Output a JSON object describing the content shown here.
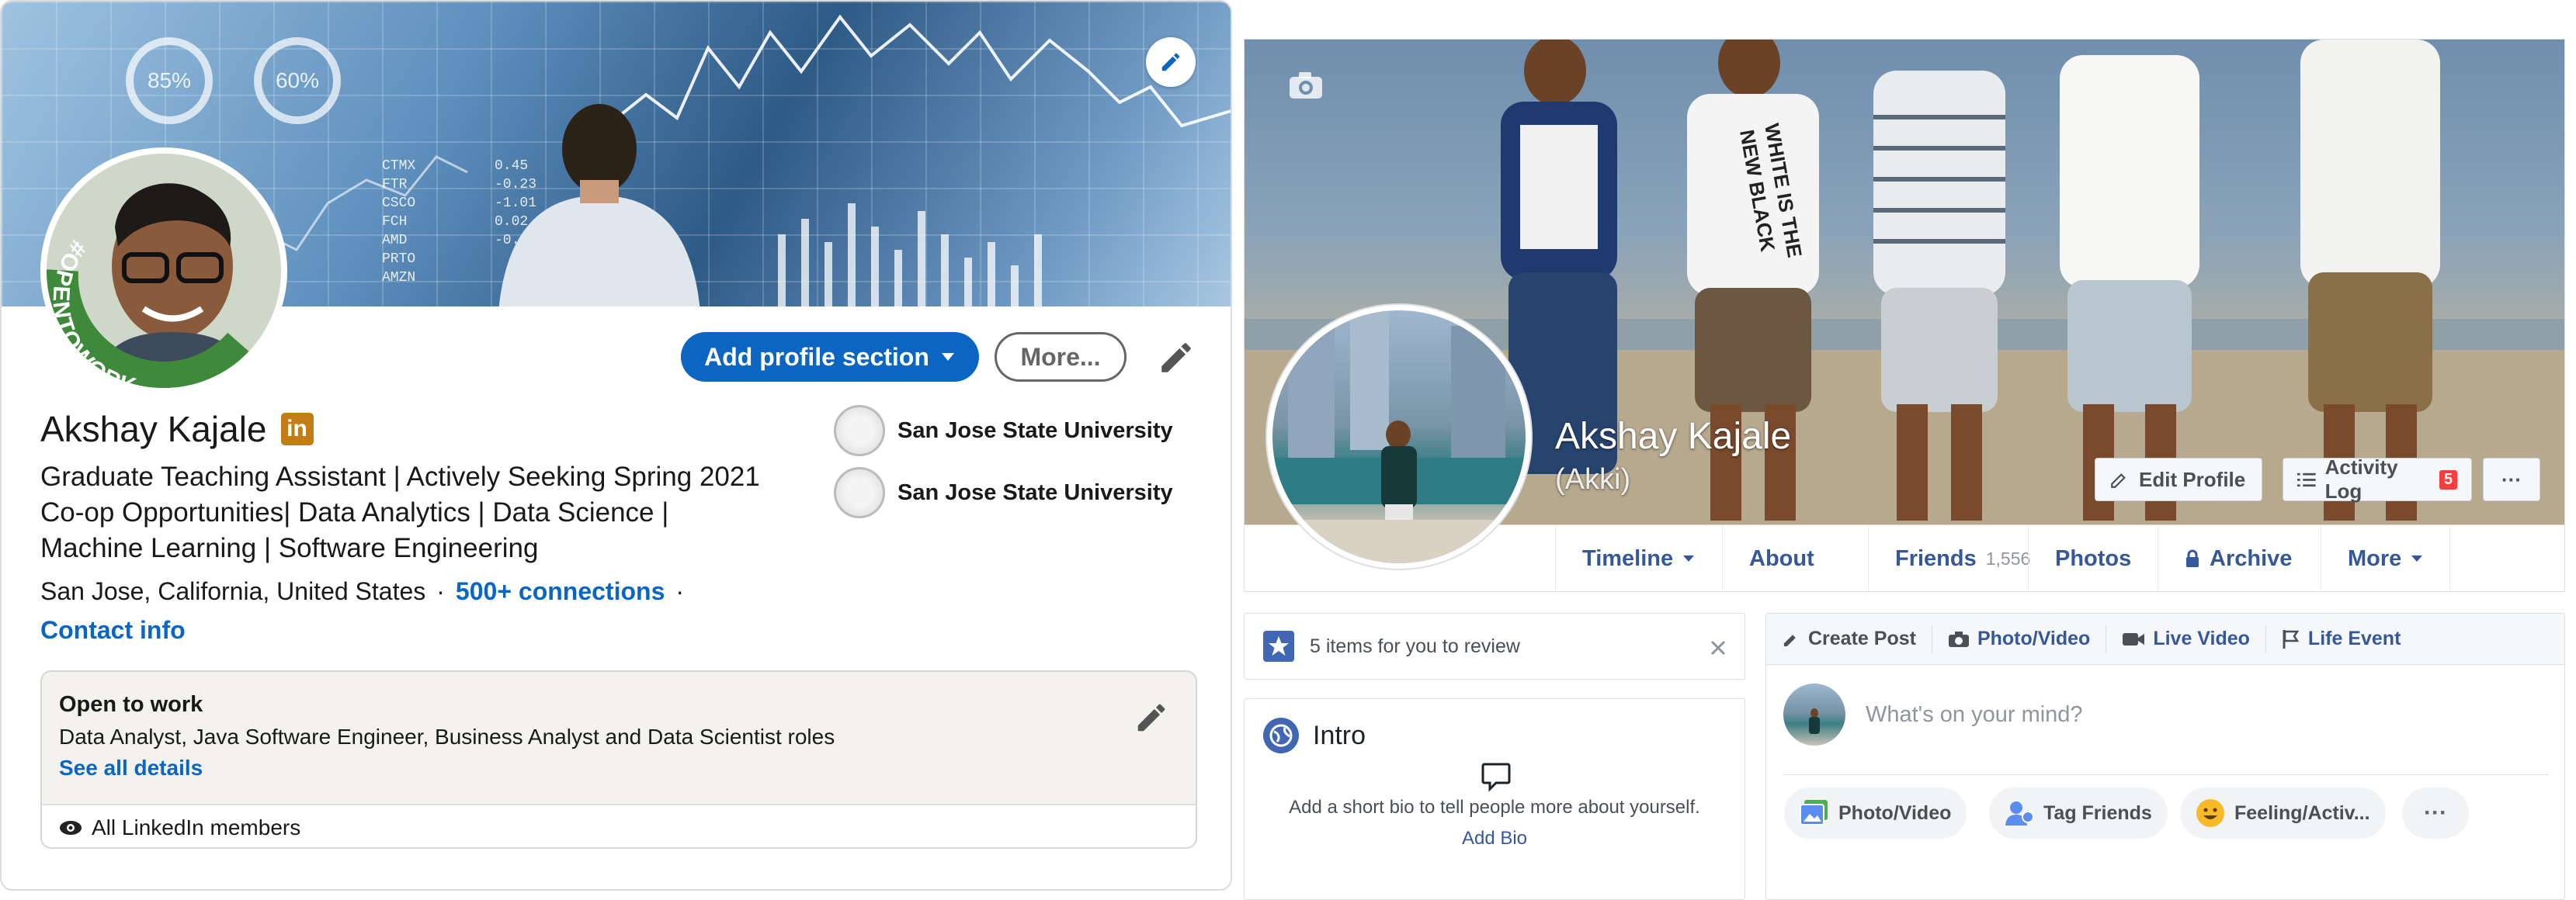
{
  "linkedin": {
    "banner_rings": [
      "85%",
      "60%"
    ],
    "banner_tickers": [
      "CTMX",
      "FTR",
      "CSCO",
      "FCH",
      "AMD",
      "PRTO",
      "AMZN"
    ],
    "banner_values": [
      "0.45",
      "-0.23",
      "-1.01",
      "0.02",
      "-0.90"
    ],
    "avatar_frame_text": "#OPENTOWORK",
    "add_section_label": "Add profile section",
    "more_label": "More...",
    "name": "Akshay Kajale",
    "headline_lines": [
      "Graduate Teaching Assistant | Actively Seeking Spring 2021",
      "Co-op Opportunities| Data Analytics | Data Science |",
      "Machine Learning | Software Engineering"
    ],
    "location": "San Jose, California, United States",
    "separator": "·",
    "connections": "500+ connections",
    "contact_info": "Contact info",
    "schools": [
      "San Jose State University",
      "San Jose State University"
    ],
    "open_to_work": {
      "title": "Open to work",
      "roles": "Data Analyst, Java Software Engineer, Business Analyst and Data Scientist roles",
      "see_all": "See all details",
      "visibility": "All LinkedIn members"
    },
    "colors": {
      "brand": "#0a66c2",
      "badge": "#c37d16",
      "opentowork": "#3f8a3a"
    }
  },
  "facebook": {
    "name": "Akshay Kajale",
    "nickname": "(Akki)",
    "edit_profile": "Edit Profile",
    "activity_log": "Activity Log",
    "activity_count": "5",
    "overflow": "···",
    "tabs": {
      "timeline": "Timeline",
      "about": "About",
      "friends": "Friends",
      "friends_count": "1,556",
      "photos": "Photos",
      "archive": "Archive",
      "more": "More"
    },
    "review": "5 items for you to review",
    "intro": {
      "title": "Intro",
      "bio_prompt": "Add a short bio to tell people more about yourself.",
      "add_bio": "Add Bio"
    },
    "composer": {
      "create_post": "Create Post",
      "photo_video": "Photo/Video",
      "live_video": "Live Video",
      "life_event": "Life Event",
      "placeholder": "What's on your mind?",
      "actions": [
        "Photo/Video",
        "Tag Friends",
        "Feeling/Activ..."
      ],
      "more": "···"
    },
    "tshirt_print": [
      "WHITE IS THE",
      "NEW BLACK"
    ],
    "colors": {
      "link": "#365899",
      "badge": "#fa3e3e",
      "star": "#4267b2"
    }
  }
}
